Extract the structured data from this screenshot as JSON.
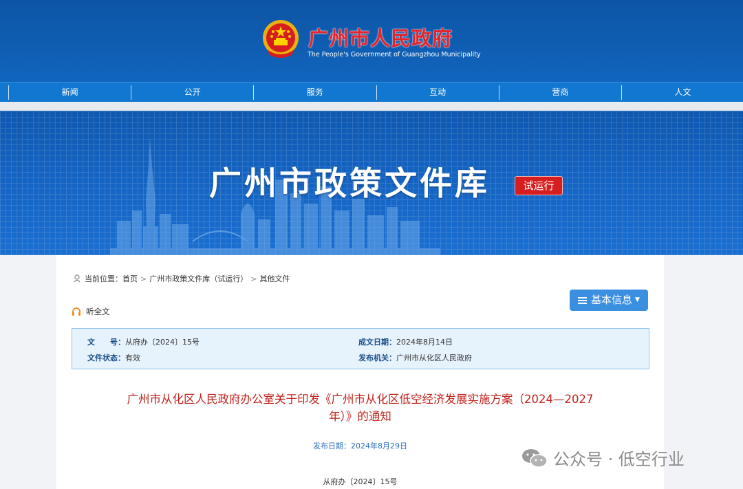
{
  "header": {
    "title": "广州市人民政府",
    "subtitle": "The People's Government of Guangzhou Municipality",
    "emblem_icon": "national-emblem-icon"
  },
  "nav": {
    "items": [
      "新闻",
      "公开",
      "服务",
      "互动",
      "营商",
      "人文"
    ]
  },
  "banner": {
    "title": "广州市政策文件库",
    "badge": "试运行"
  },
  "breadcrumb": {
    "prefix": "当前位置：",
    "items": [
      "首页",
      "广州市政策文件库（试运行）",
      "其他文件"
    ],
    "separator": ">"
  },
  "listen": {
    "label": "听全文"
  },
  "basic_info_button": {
    "label": "基本信息"
  },
  "info": {
    "doc_no_label": "文　　号：",
    "doc_no_value": "从府办〔2024〕15号",
    "status_label": "文件状态：",
    "status_value": "有效",
    "date_label": "成文日期：",
    "date_value": "2024年8月14日",
    "issuer_label": "发布机关：",
    "issuer_value": "广州市从化区人民政府"
  },
  "document": {
    "title_line1": "广州市从化区人民政府办公室关于印发《广州市从化区低空经济发展实施方案（2024—2027",
    "title_line2": "年）》的通知",
    "publish_date": "发布日期：2024年8月29日",
    "doc_number": "从府办〔2024〕15号"
  },
  "watermark": {
    "text": "公众号 · 低空行业"
  },
  "colors": {
    "header_blue": "#0f5eb3",
    "nav_blue": "#1177d0",
    "title_red": "#c0221b",
    "badge_red": "#d71e1e",
    "button_blue": "#3a8fe0",
    "info_bg": "#e6f2fc"
  }
}
